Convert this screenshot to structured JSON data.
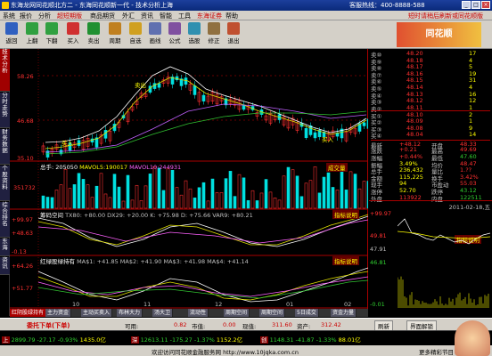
{
  "title": {
    "text": "东海龙网同花顺北方二 - 东海同花顺新一代 - 技术分析上海",
    "hotline": "客服热线：400-8888-588",
    "window_buttons": [
      "_",
      "□",
      "×"
    ]
  },
  "menu": {
    "items": [
      "系统",
      "报价",
      "分析",
      "超短期版",
      "商品期货",
      "外汇",
      "资讯",
      "智能",
      "工具",
      "东海证券",
      "帮助"
    ],
    "ad": "短时请稍后刷新或同花顺版"
  },
  "toolbar": {
    "buttons": [
      "返回",
      "上翻",
      "下翻",
      "买入",
      "卖出",
      "周期",
      "自选",
      "画线",
      "公式",
      "选股",
      "修正",
      "退出"
    ],
    "logo": "同花顺"
  },
  "sidebar": {
    "tabs": [
      "技术分析",
      "分时走势",
      "财务数据",
      "个股资料",
      "综合排名",
      "东海",
      "资讯"
    ]
  },
  "price_chart": {
    "axis": [
      "58.26",
      "46.68",
      "35.10"
    ],
    "annotations": [
      "卖出",
      "买入",
      "买入"
    ]
  },
  "volume": {
    "header_label": "总手",
    "header_value": "205050",
    "ma5_label": "MAVOL5:",
    "ma5_value": "190017",
    "ma10_label": "MAVOL10:",
    "ma10_value": "244931",
    "axis": [
      "351732"
    ],
    "badge": "成交量"
  },
  "indicator1": {
    "name": "筹码空间",
    "values": "TX80: +80.00  DX29: +20.00  K: +75.98  D: +75.66  VAR9: +80.21",
    "axis": [
      "+99.97",
      "+48.63",
      "-0.13"
    ],
    "help": "指标说明"
  },
  "indicator2": {
    "name": "红绿股绿持有",
    "values": "MA$1: +41.85  MA$2: +41.90  MA$3: +41.98  MA$4: +41.14",
    "axis": [
      "+64.26",
      "+51.77"
    ],
    "help": "指标说明"
  },
  "x_axis": {
    "labels": [
      "10",
      "11",
      "12",
      "01",
      "02"
    ]
  },
  "tabs": {
    "items": [
      "红阴股绿持有",
      "主力资金",
      "主动买卖入",
      "布林大力",
      "汤大卫",
      "流动性",
      "周期空间",
      "周期空间",
      "5日成交",
      "资金力量"
    ]
  },
  "quote": {
    "asks": [
      {
        "label": "卖⑩",
        "price": "48.20",
        "vol": "17"
      },
      {
        "label": "卖⑨",
        "price": "48.18",
        "vol": "4"
      },
      {
        "label": "卖⑧",
        "price": "48.17",
        "vol": "5"
      },
      {
        "label": "卖⑦",
        "price": "48.16",
        "vol": "19"
      },
      {
        "label": "卖⑥",
        "price": "48.15",
        "vol": "31"
      },
      {
        "label": "卖⑤",
        "price": "48.14",
        "vol": "4"
      },
      {
        "label": "卖④",
        "price": "48.13",
        "vol": "16"
      },
      {
        "label": "卖③",
        "price": "48.12",
        "vol": "12"
      },
      {
        "label": "卖②",
        "price": "48.11",
        "vol": "1"
      },
      {
        "label": "买①",
        "price": "48.10",
        "vol": "2"
      },
      {
        "label": "买②",
        "price": "48.09",
        "vol": "1"
      },
      {
        "label": "买③",
        "price": "48.08",
        "vol": "9"
      },
      {
        "label": "买④",
        "price": "48.04",
        "vol": "14"
      }
    ],
    "stats": [
      {
        "l1": "最新",
        "v1": "+48.12",
        "l2": "开盘",
        "v2": "48.33"
      },
      {
        "l1": "涨跌",
        "v1": "+0.21",
        "l2": "最高",
        "v2": "49.69"
      },
      {
        "l1": "涨幅",
        "v1": "+0.44%",
        "l2": "最低",
        "v2": "47.60"
      },
      {
        "l1": "振幅",
        "v1": "3.49%",
        "l2": "均价",
        "v2": "48.47"
      },
      {
        "l1": "总手",
        "v1": "236,432",
        "l2": "量比",
        "v2": "1.??"
      },
      {
        "l1": "金额",
        "v1": "115,225",
        "l2": "换手",
        "v2": "3.42%"
      },
      {
        "l1": "现手",
        "v1": "94",
        "l2": "市盈动",
        "v2": "55.03"
      },
      {
        "l1": "涨停",
        "v1": "52.70",
        "l2": "跌停",
        "v2": "43.12"
      },
      {
        "l1": "外盘",
        "v1": "113922",
        "l2": "内盘",
        "v2": "122511"
      }
    ],
    "date_label": "2011-02-18,五",
    "mini_axis": [
      "+99.97",
      "49.81",
      "47.91",
      "46.81",
      "-0.01"
    ],
    "mini_help": "指标说明"
  },
  "order_bar": {
    "title": "委托下单(下单)",
    "buy_label": "可用:",
    "buy_value": "0.82",
    "shares_label": "市值:",
    "shares_value": "0.00",
    "cash_label": "现值:",
    "cash_value": "311.60",
    "asset_label": "资产:",
    "asset_value": "312.42",
    "refresh": "刷新",
    "unlock": "界面解锁"
  },
  "status": {
    "items": [
      {
        "name": "上",
        "v": "2899.79",
        "c": "-27.17",
        "p": "-0.93%",
        "a": "1435.0亿"
      },
      {
        "name": "深",
        "v": "12613.11",
        "c": "-175.27",
        "p": "-1.37%",
        "a": "1152.2亿"
      },
      {
        "name": "创",
        "v": "1148.31",
        "c": "-41.87",
        "p": "-1.33%",
        "a": "88.01亿"
      }
    ]
  },
  "bottom": {
    "text": "欢迎访问同花顺金融服务网 http://www.10jqka.com.cn",
    "more": "更多精彩节目"
  },
  "colors": {
    "up": "#ff3030",
    "down": "#30d030",
    "yellow": "#ffff00",
    "cyan": "#00e0e0"
  }
}
